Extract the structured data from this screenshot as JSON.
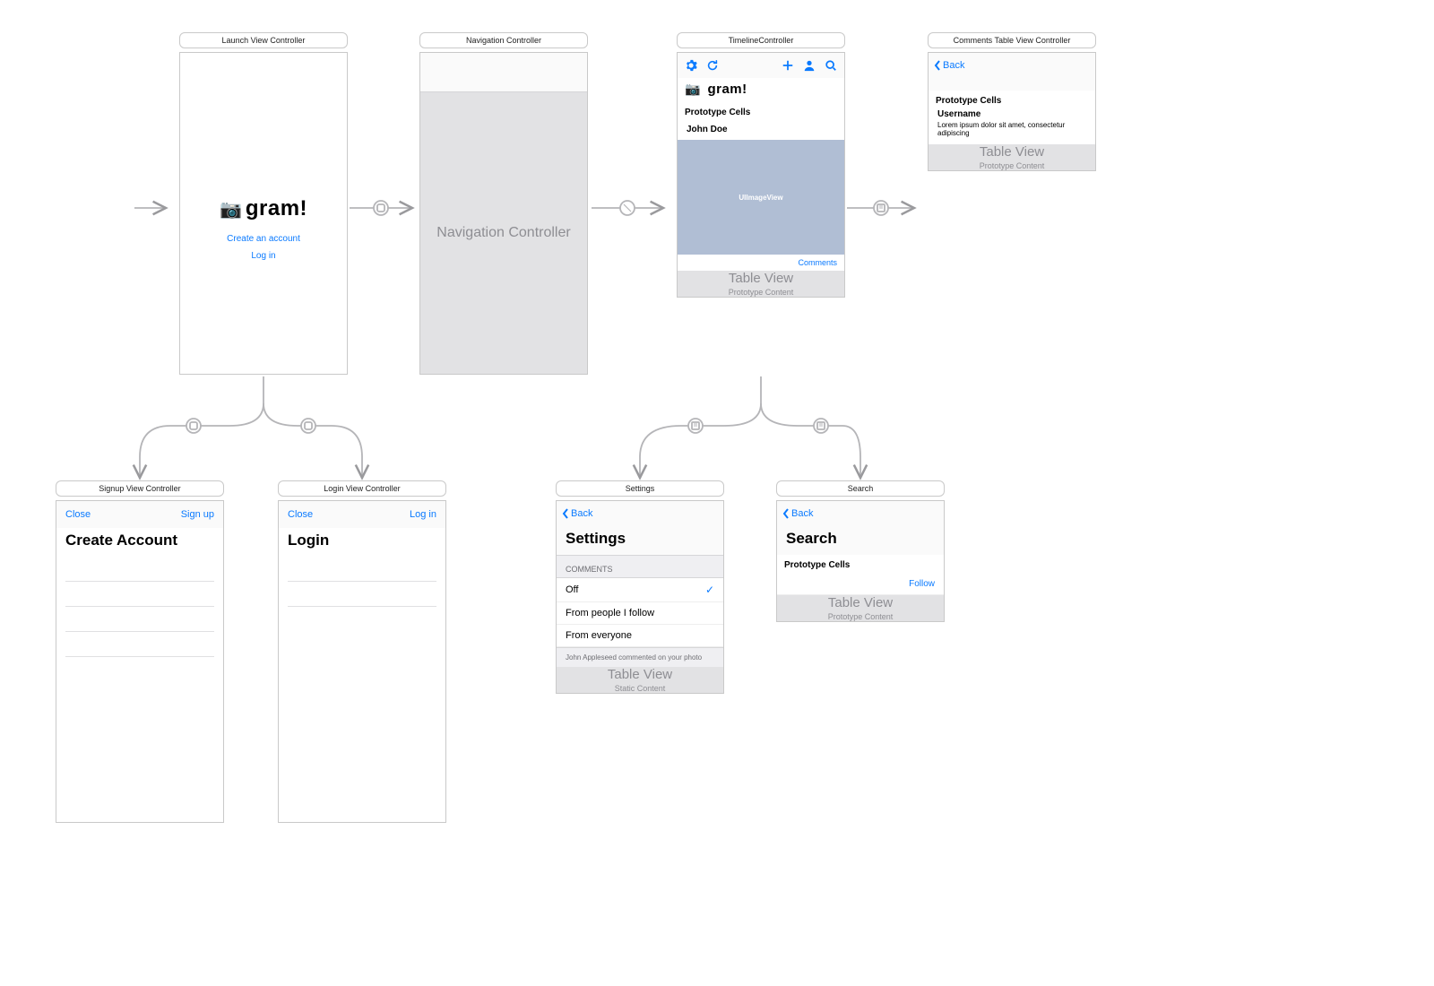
{
  "colors": {
    "accent": "#0a7aff",
    "grey_bg": "#e2e2e4",
    "imageview_bg": "#b0bed4"
  },
  "brand": {
    "name": "gram!",
    "icon": "📷"
  },
  "scenes": {
    "launch": {
      "label": "Launch View Controller",
      "links": {
        "create": "Create an account",
        "login": "Log in"
      }
    },
    "nav": {
      "label": "Navigation Controller",
      "body": "Navigation Controller"
    },
    "timeline": {
      "label": "TimelineController",
      "prototype_header": "Prototype Cells",
      "user": "John Doe",
      "image_label": "UIImageView",
      "comments_link": "Comments",
      "tv_title": "Table View",
      "tv_subtitle": "Prototype Content"
    },
    "comments": {
      "label": "Comments Table View Controller",
      "back": "Back",
      "prototype_header": "Prototype Cells",
      "username": "Username",
      "lorem": "Lorem ipsum dolor sit amet, consectetur adipiscing",
      "tv_title": "Table View",
      "tv_subtitle": "Prototype Content"
    },
    "signup": {
      "label": "Signup View Controller",
      "close": "Close",
      "action": "Sign up",
      "title": "Create Account"
    },
    "login": {
      "label": "Login View Controller",
      "close": "Close",
      "action": "Log in",
      "title": "Login"
    },
    "settings": {
      "label": "Settings",
      "back": "Back",
      "title": "Settings",
      "group": "COMMENTS",
      "rows": [
        "Off",
        "From people I follow",
        "From everyone"
      ],
      "footer": "John Appleseed commented on your photo",
      "tv_title": "Table View",
      "tv_subtitle": "Static Content"
    },
    "search": {
      "label": "Search",
      "back": "Back",
      "title": "Search",
      "prototype_header": "Prototype Cells",
      "follow": "Follow",
      "tv_title": "Table View",
      "tv_subtitle": "Prototype Content"
    }
  }
}
